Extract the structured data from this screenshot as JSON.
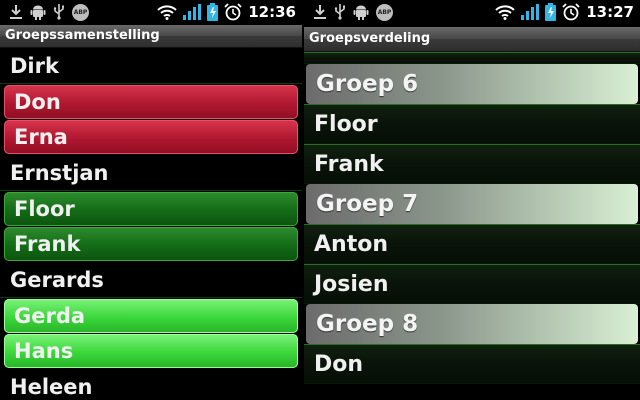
{
  "left": {
    "status": {
      "time": "12:36"
    },
    "title": "Groepssamenstelling",
    "items": [
      {
        "name": "Dirk",
        "state": "plain"
      },
      {
        "name": "Don",
        "state": "red"
      },
      {
        "name": "Erna",
        "state": "red"
      },
      {
        "name": "Ernstjan",
        "state": "plain"
      },
      {
        "name": "Floor",
        "state": "dgreen"
      },
      {
        "name": "Frank",
        "state": "dgreen"
      },
      {
        "name": "Gerards",
        "state": "plain"
      },
      {
        "name": "Gerda",
        "state": "lgreen"
      },
      {
        "name": "Hans",
        "state": "lgreen"
      },
      {
        "name": "Heleen",
        "state": "plain"
      }
    ]
  },
  "right": {
    "status": {
      "time": "13:27"
    },
    "title": "Groepsverdeling",
    "items": [
      {
        "type": "partial",
        "label": ""
      },
      {
        "type": "group",
        "label": "Groep 6"
      },
      {
        "type": "member",
        "label": "Floor"
      },
      {
        "type": "member",
        "label": "Frank"
      },
      {
        "type": "group",
        "label": "Groep 7"
      },
      {
        "type": "member",
        "label": "Anton"
      },
      {
        "type": "member",
        "label": "Josien"
      },
      {
        "type": "group",
        "label": "Groep 8"
      },
      {
        "type": "member",
        "label": "Don"
      }
    ]
  },
  "status_icons": {
    "download": "download-icon",
    "android": "android-icon",
    "usb": "usb-icon",
    "abp": "ABP",
    "wifi": "wifi-icon",
    "signal": "signal-icon",
    "battery": "battery-charging-icon",
    "alarm": "alarm-icon"
  },
  "colors": {
    "red_row": "#b01730",
    "dark_green_row": "#136b16",
    "light_green_row": "#3bd73b",
    "group_header": "#8a958a"
  }
}
